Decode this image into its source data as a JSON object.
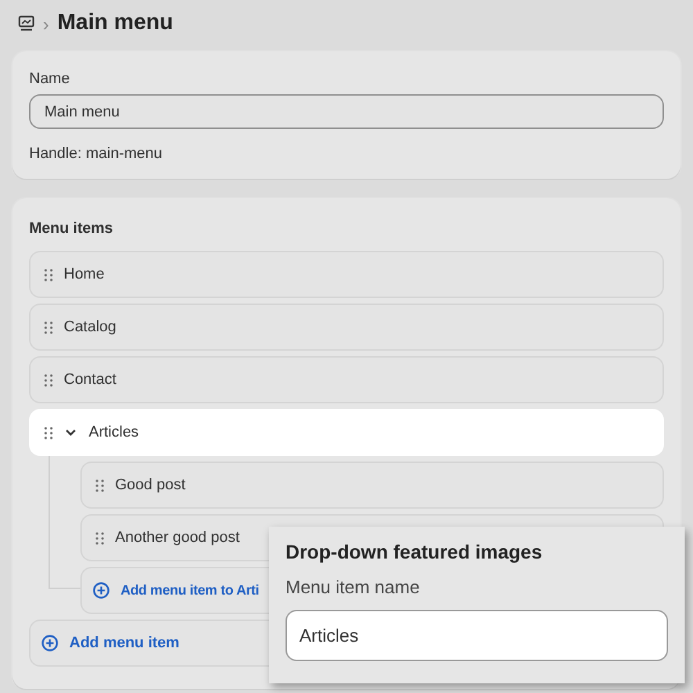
{
  "breadcrumb": {
    "separator": "›",
    "title": "Main menu"
  },
  "name_card": {
    "label": "Name",
    "value": "Main menu",
    "handle": "Handle: main-menu"
  },
  "menu_items": {
    "title": "Menu items",
    "items": [
      {
        "label": "Home",
        "selected": false
      },
      {
        "label": "Catalog",
        "selected": false
      },
      {
        "label": "Contact",
        "selected": false
      },
      {
        "label": "Articles",
        "selected": true,
        "expanded": true,
        "add_child": "Add menu item to Arti",
        "children": [
          {
            "label": "Good post",
            "selected": false
          },
          {
            "label": "Another good post",
            "selected": false
          }
        ]
      }
    ],
    "add_button": "Add menu item"
  },
  "popover": {
    "title": "Drop-down featured images",
    "field_label": "Menu item name",
    "field_value": "Articles"
  }
}
